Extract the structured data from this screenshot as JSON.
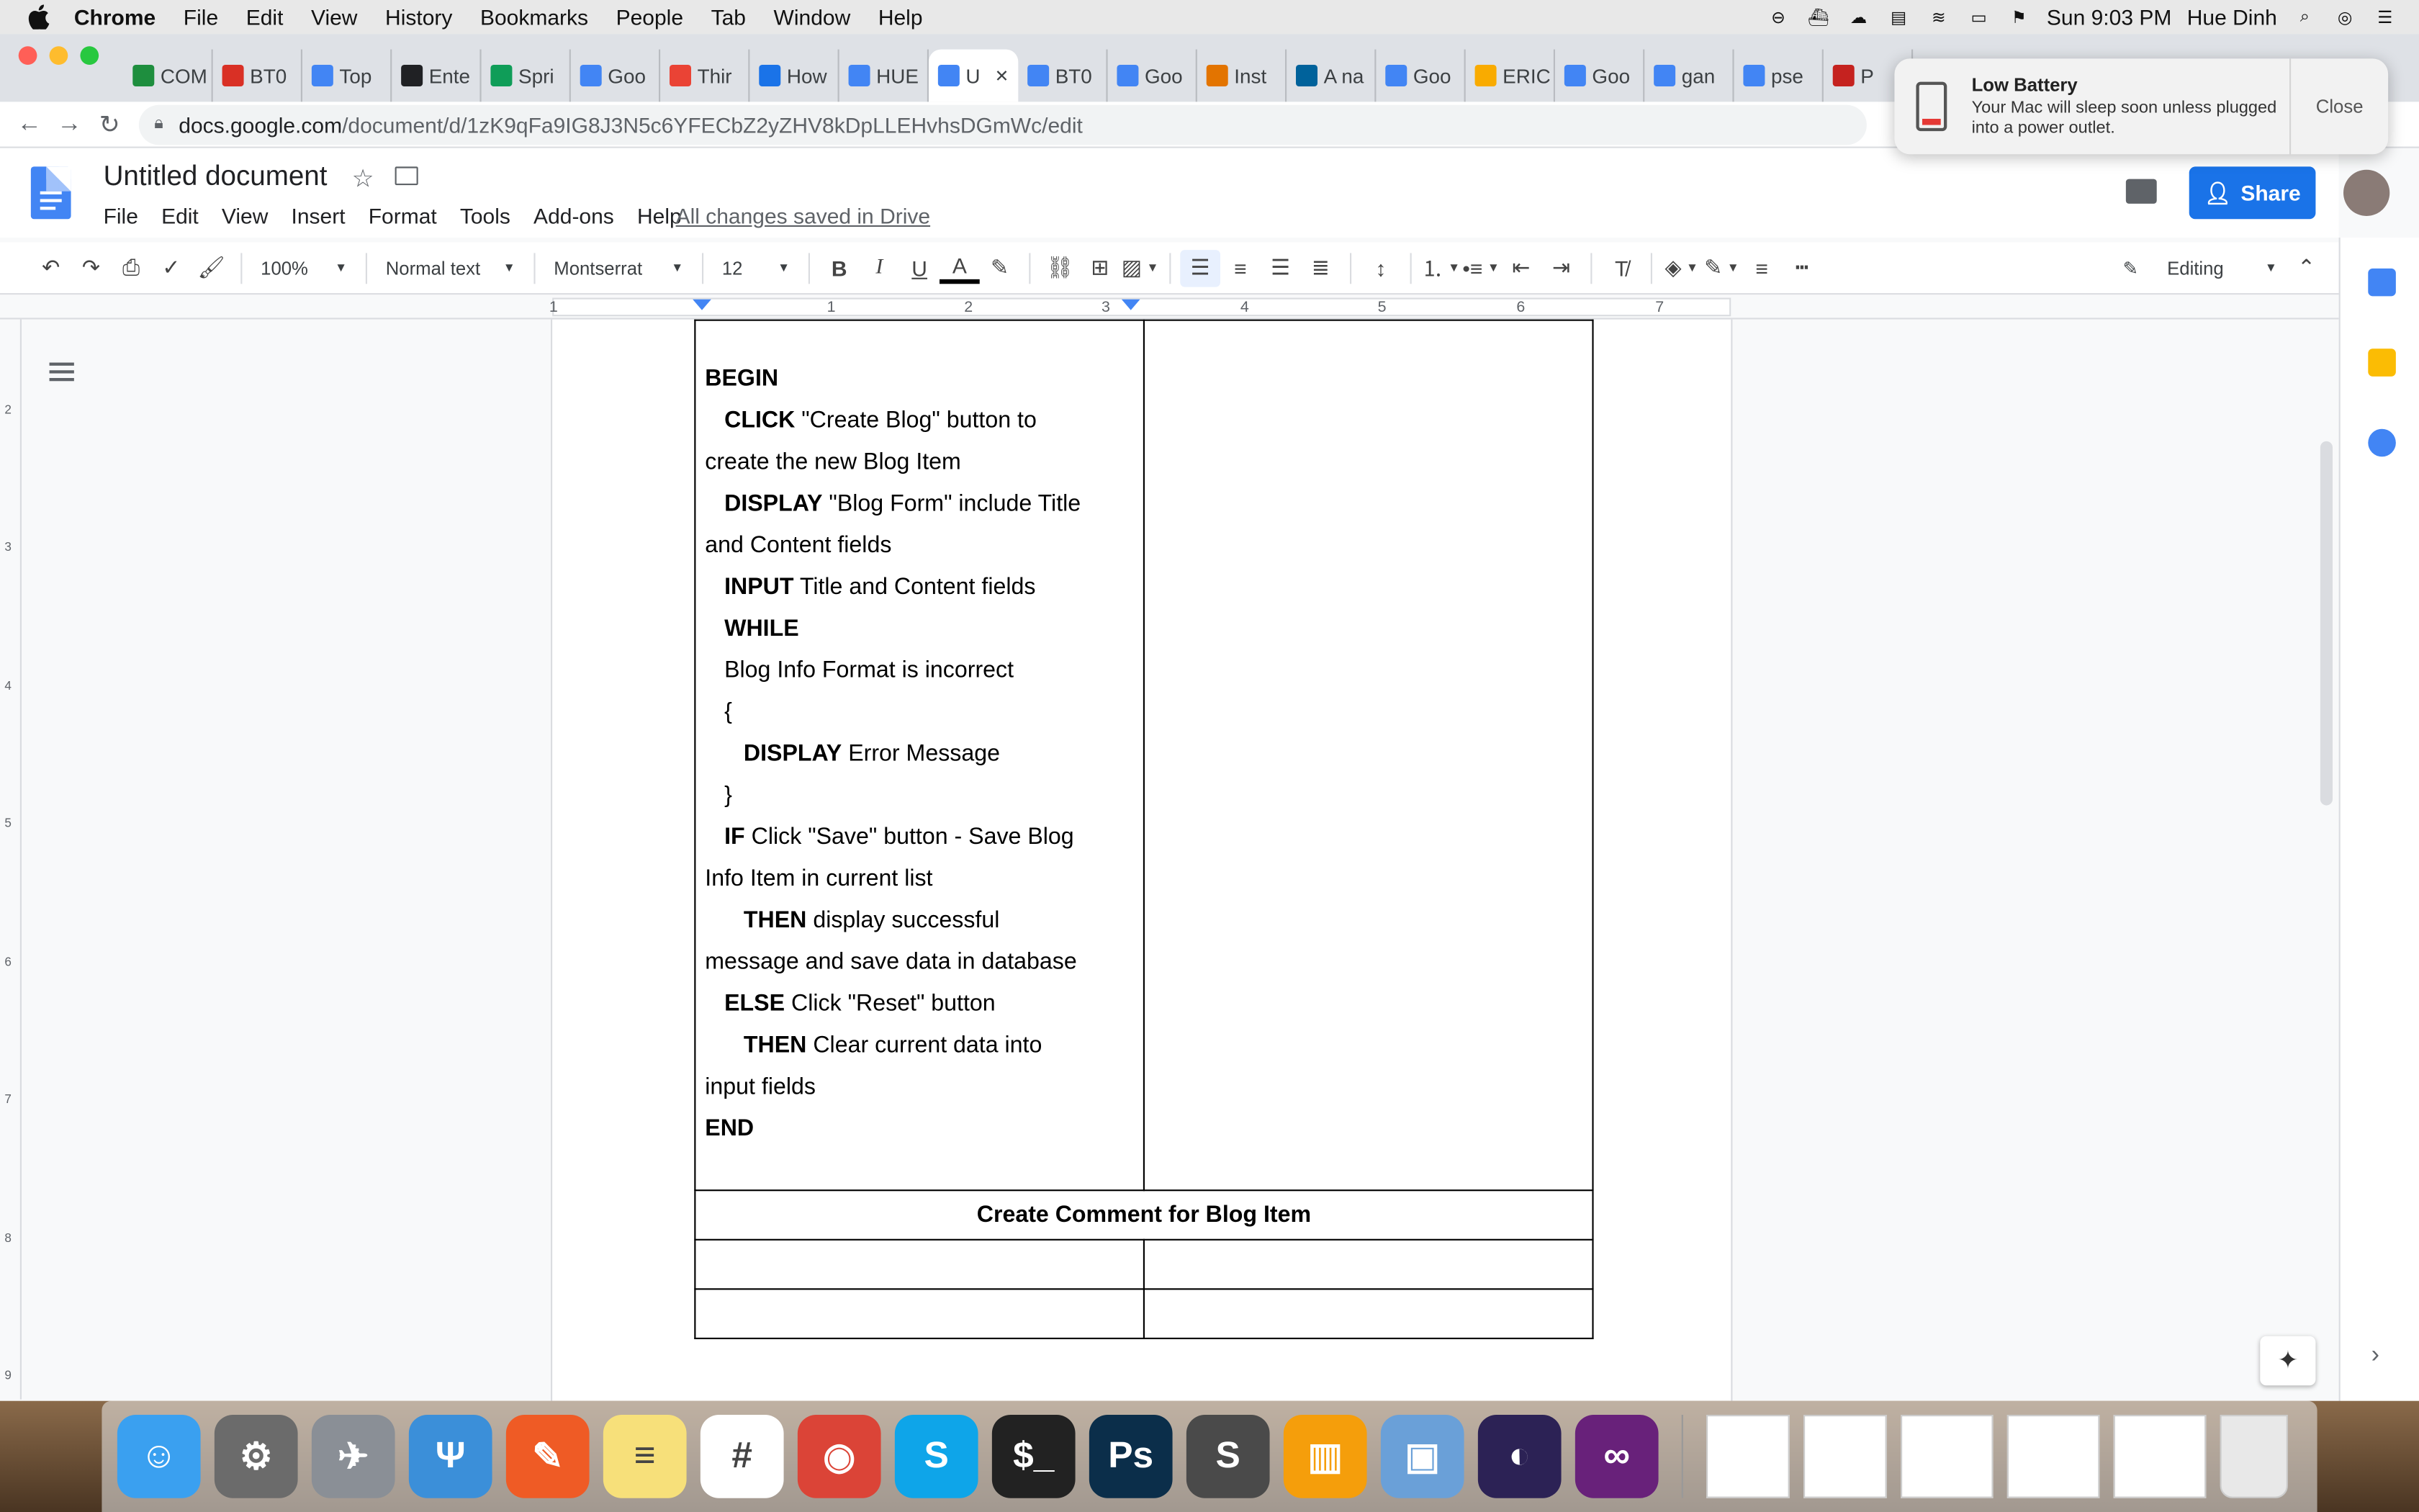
{
  "menubar": {
    "app": "Chrome",
    "items": [
      "File",
      "Edit",
      "View",
      "History",
      "Bookmarks",
      "People",
      "Tab",
      "Window",
      "Help"
    ],
    "clock": "Sun 9:03 PM",
    "user": "Hue Dinh"
  },
  "tabs": [
    {
      "label": "COM",
      "color": "#1e8e3e",
      "icon": "drive-icon"
    },
    {
      "label": "BT0",
      "color": "#d93025",
      "icon": "pdf-icon"
    },
    {
      "label": "Top",
      "color": "#4285f4",
      "icon": "docs-icon"
    },
    {
      "label": "Ente",
      "color": "#202124",
      "icon": "mask-icon"
    },
    {
      "label": "Spri",
      "color": "#0f9d58",
      "icon": "sheets-icon"
    },
    {
      "label": "Goo",
      "color": "#4285f4",
      "icon": "translate-icon"
    },
    {
      "label": "Thir",
      "color": "#ea4335",
      "icon": "star-icon"
    },
    {
      "label": "How",
      "color": "#1a73e8",
      "icon": "link-icon"
    },
    {
      "label": "HUE",
      "color": "#4285f4",
      "icon": "docs-icon"
    },
    {
      "label": "U",
      "color": "#4285f4",
      "icon": "docs-icon",
      "active": true
    },
    {
      "label": "BT0",
      "color": "#4285f4",
      "icon": "docs-icon"
    },
    {
      "label": "Goo",
      "color": "#4285f4",
      "icon": "translate-icon"
    },
    {
      "label": "Inst",
      "color": "#e37400",
      "icon": "e-icon"
    },
    {
      "label": "A na",
      "color": "#00629b",
      "icon": "ieee-icon"
    },
    {
      "label": "Goo",
      "color": "#4285f4",
      "icon": "translate-icon"
    },
    {
      "label": "ERIC",
      "color": "#f9ab00",
      "icon": "sun-icon"
    },
    {
      "label": "Goo",
      "color": "#4285f4",
      "icon": "translate-icon"
    },
    {
      "label": "gan",
      "color": "#4285f4",
      "icon": "google-icon"
    },
    {
      "label": "pse",
      "color": "#4285f4",
      "icon": "google-icon"
    },
    {
      "label": "P",
      "color": "#c5221f",
      "icon": "p-icon"
    }
  ],
  "address": {
    "host": "docs.google.com",
    "path": "/document/d/1zK9qFa9IG8J3N5c6YFECbZ2yZHV8kDpLLEHvhsDGmWc/edit"
  },
  "notification": {
    "title": "Low Battery",
    "body": "Your Mac will sleep soon unless plugged into a power outlet.",
    "close": "Close"
  },
  "doc": {
    "title": "Untitled document",
    "menu": [
      "File",
      "Edit",
      "View",
      "Insert",
      "Format",
      "Tools",
      "Add-ons",
      "Help"
    ],
    "saved": "All changes saved in Drive",
    "share": "Share"
  },
  "toolbar": {
    "zoom": "100%",
    "style": "Normal text",
    "font": "Montserrat",
    "size": "12",
    "mode": "Editing"
  },
  "ruler": {
    "marks": [
      "1",
      "1",
      "2",
      "3",
      "4",
      "5",
      "6",
      "7"
    ]
  },
  "vruler": {
    "marks": [
      "2",
      "3",
      "4",
      "5",
      "6",
      "7",
      "8",
      "9"
    ]
  },
  "table": {
    "code": [
      {
        "indent": "",
        "kw": "BEGIN",
        "rest": ""
      },
      {
        "indent": "   ",
        "kw": "CLICK",
        "rest": " \"Create Blog\" button to"
      },
      {
        "indent": "",
        "kw": "",
        "rest": "create the new Blog Item"
      },
      {
        "indent": "   ",
        "kw": "DISPLAY",
        "rest": " \"Blog Form\" include Title"
      },
      {
        "indent": "",
        "kw": "",
        "rest": "and Content fields"
      },
      {
        "indent": "   ",
        "kw": "INPUT",
        "rest": " Title and Content fields"
      },
      {
        "indent": "   ",
        "kw": "WHILE",
        "rest": ""
      },
      {
        "indent": "   ",
        "kw": "",
        "rest": "Blog Info Format is incorrect"
      },
      {
        "indent": "   ",
        "kw": "",
        "rest": "{"
      },
      {
        "indent": "      ",
        "kw": "DISPLAY",
        "rest": " Error Message"
      },
      {
        "indent": "   ",
        "kw": "",
        "rest": "}"
      },
      {
        "indent": "   ",
        "kw": "IF",
        "rest": " Click \"Save\" button - Save Blog"
      },
      {
        "indent": "",
        "kw": "",
        "rest": "Info Item in current list"
      },
      {
        "indent": "      ",
        "kw": "THEN",
        "rest": " display successful"
      },
      {
        "indent": "",
        "kw": "",
        "rest": "message and save data in database"
      },
      {
        "indent": "   ",
        "kw": "ELSE",
        "rest": " Click \"Reset\" button"
      },
      {
        "indent": "      ",
        "kw": "THEN",
        "rest": " Clear current data into"
      },
      {
        "indent": "",
        "kw": "",
        "rest": "input fields"
      },
      {
        "indent": "",
        "kw": "END",
        "rest": ""
      }
    ],
    "section_header": "Create Comment for Blog Item"
  },
  "dock": [
    {
      "name": "finder",
      "color": "#3aa0f0",
      "glyph": "☺"
    },
    {
      "name": "system-preferences",
      "color": "#6b6b6b",
      "glyph": "⚙"
    },
    {
      "name": "launchpad",
      "color": "#8a8f96",
      "glyph": "✈"
    },
    {
      "name": "fork",
      "color": "#3b8fd9",
      "glyph": "Ψ"
    },
    {
      "name": "postman",
      "color": "#ef5b25",
      "glyph": "✎"
    },
    {
      "name": "notes",
      "color": "#f7e07a",
      "glyph": "≡"
    },
    {
      "name": "slack",
      "color": "#ffffff",
      "glyph": "#"
    },
    {
      "name": "chrome",
      "color": "#db4437",
      "glyph": "◉"
    },
    {
      "name": "skype",
      "color": "#0ea5e9",
      "glyph": "S"
    },
    {
      "name": "terminal",
      "color": "#222222",
      "glyph": "$_"
    },
    {
      "name": "photoshop",
      "color": "#0b2e4a",
      "glyph": "Ps"
    },
    {
      "name": "sublime-text",
      "color": "#4a4a4a",
      "glyph": "S"
    },
    {
      "name": "books",
      "color": "#f59e0b",
      "glyph": "▥"
    },
    {
      "name": "preview",
      "color": "#6aa0d8",
      "glyph": "▣"
    },
    {
      "name": "eclipse",
      "color": "#2c2255",
      "glyph": "◐"
    },
    {
      "name": "visual-studio",
      "color": "#68217a",
      "glyph": "∞"
    }
  ]
}
